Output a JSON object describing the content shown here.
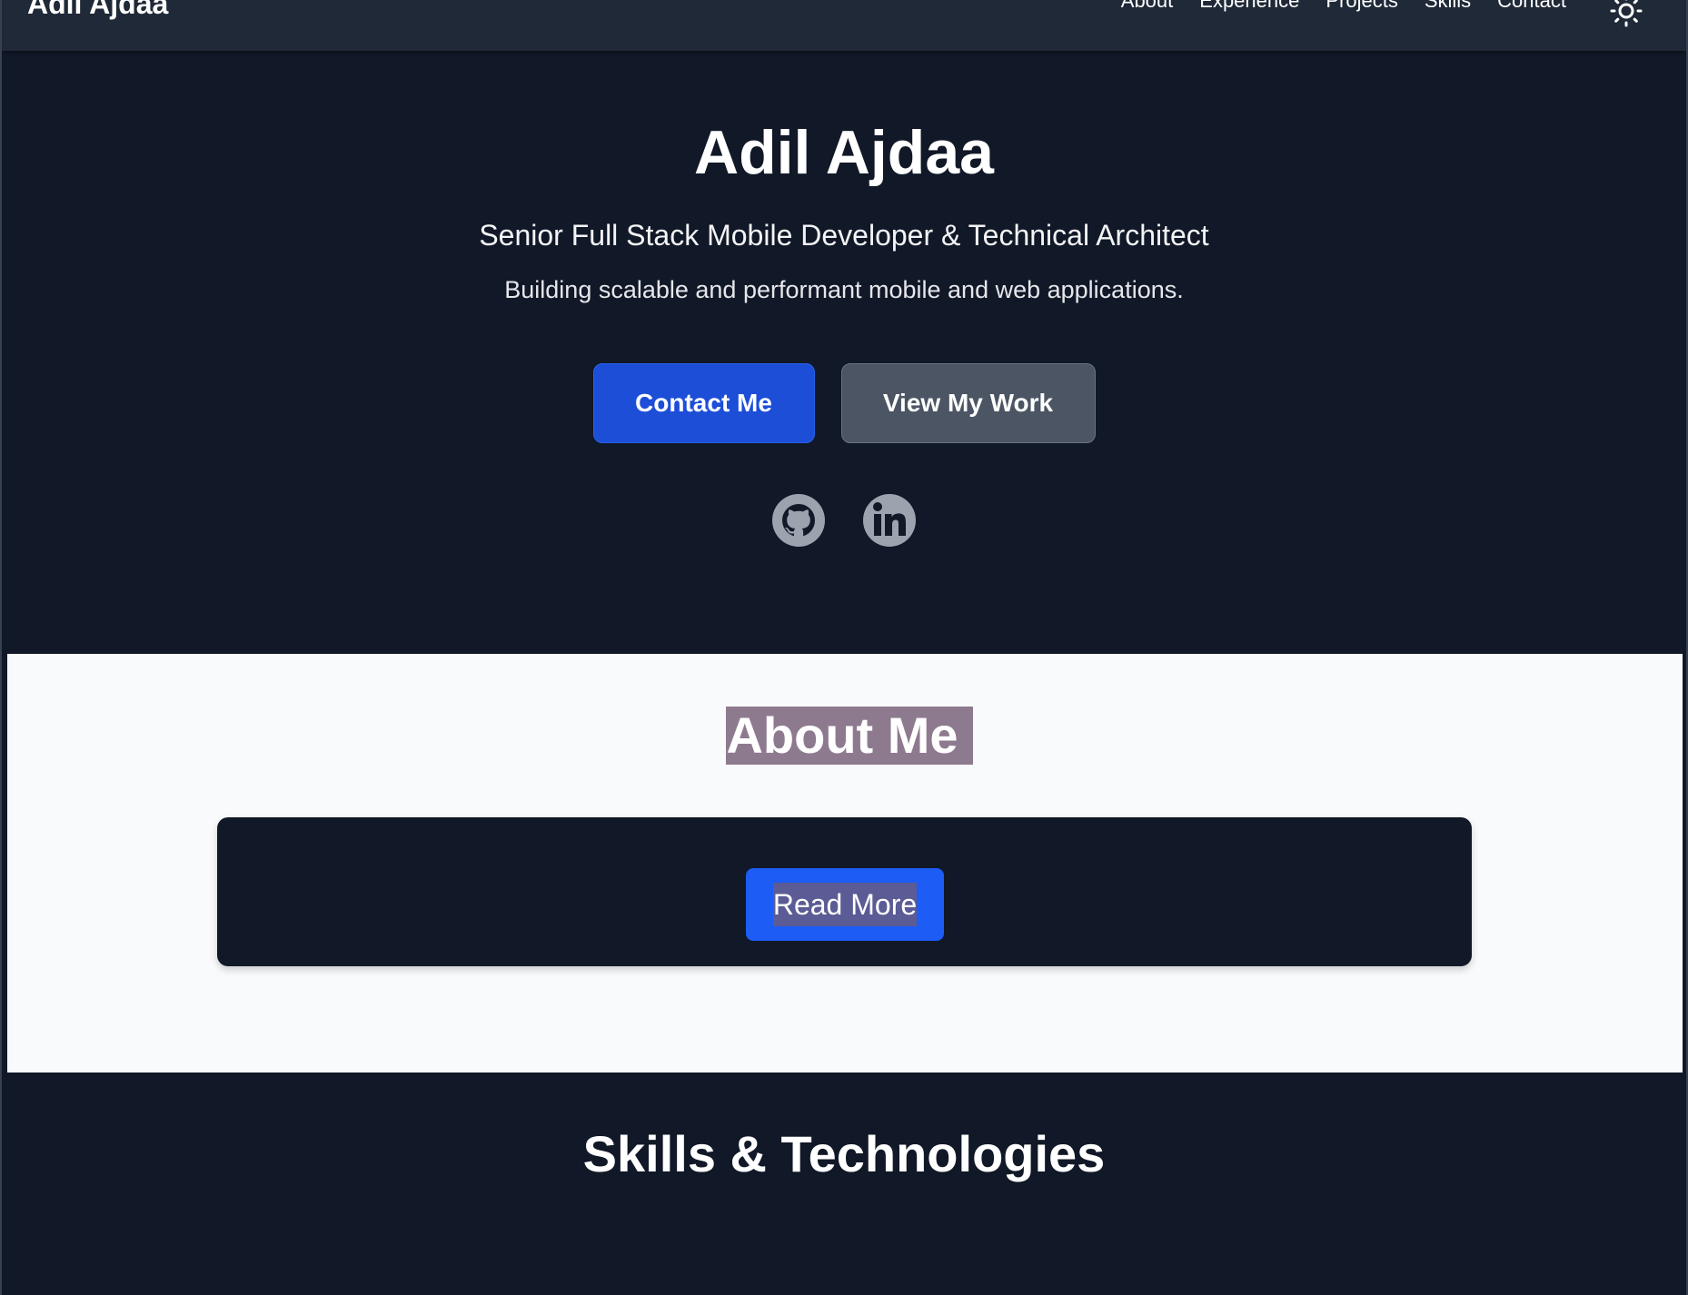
{
  "navbar": {
    "brand": "Adil Ajdaa",
    "links": [
      "About",
      "Experience",
      "Projects",
      "Skills",
      "Contact"
    ],
    "theme_icon": "sun-icon"
  },
  "hero": {
    "title": "Adil Ajdaa",
    "subtitle": "Senior Full Stack Mobile Developer & Technical Architect",
    "tagline": "Building scalable and performant mobile and web applications.",
    "primary_button": "Contact Me",
    "secondary_button": "View My Work",
    "socials": [
      {
        "name": "GitHub",
        "icon": "github-icon"
      },
      {
        "name": "LinkedIn",
        "icon": "linkedin-icon"
      }
    ]
  },
  "about": {
    "title": "About Me",
    "read_more": "Read More"
  },
  "skills": {
    "title": "Skills & Technologies"
  },
  "colors": {
    "background": "#111827",
    "navbar": "#1f2937",
    "primary": "#1d4ed8",
    "secondary": "#4b5563",
    "about_bg": "#f9fafb",
    "selection_highlight": "#8e7a8f",
    "icon_gray": "#9ca3af"
  }
}
